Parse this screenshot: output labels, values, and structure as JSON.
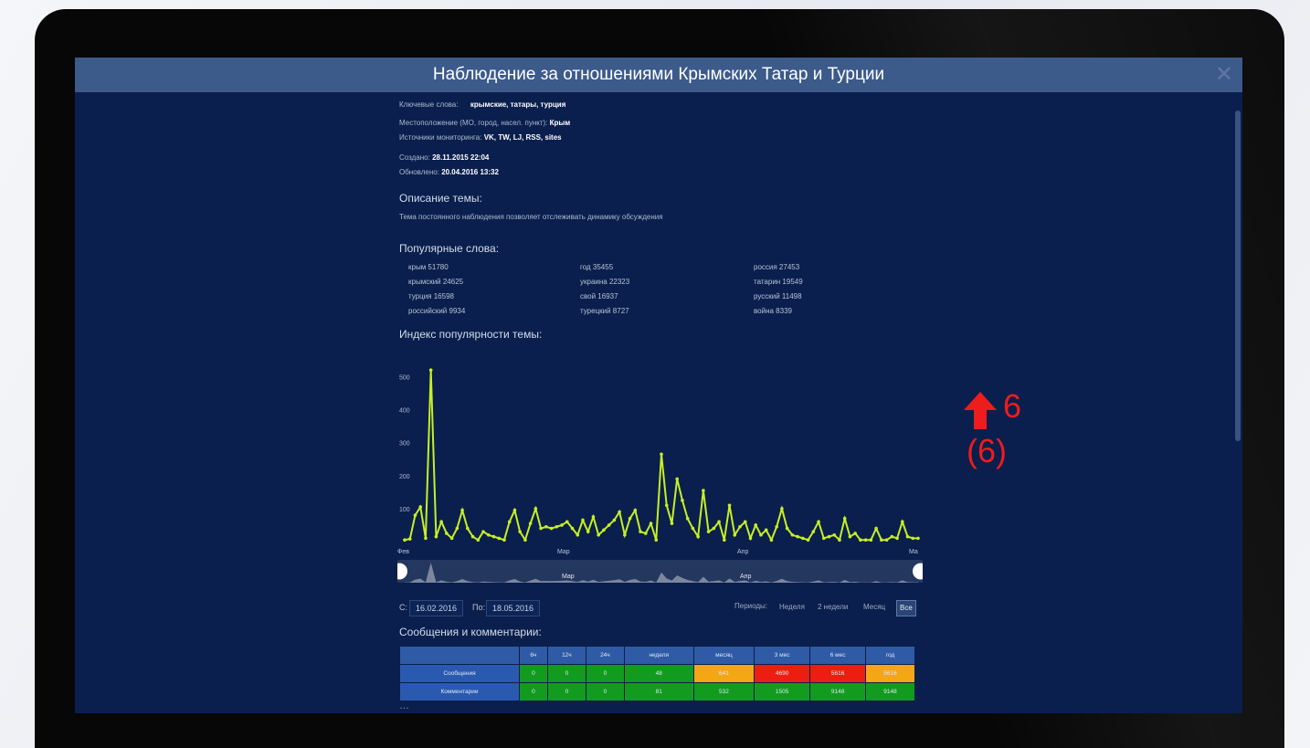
{
  "window": {
    "title": "Наблюдение за отношениями Крымских Татар и Турции",
    "close": "✕"
  },
  "meta": {
    "keywords_label": "Ключевые слова:",
    "keywords_value": "крымские, татары, турция",
    "location_label": "Местоположение (МО, город, насел. пункт):",
    "location_value": "Крым",
    "sources_label": "Источники мониторинга:",
    "sources_value": "VK, TW, LJ, RSS, sites",
    "created_label": "Создано:",
    "created_value": "28.11.2015 22:04",
    "updated_label": "Обновлено:",
    "updated_value": "20.04.2016 13:32"
  },
  "description": {
    "heading": "Описание темы:",
    "text": "Тема постоянного наблюдения позволяет отслеживать динамику обсуждения"
  },
  "popular_words": {
    "heading": "Популярные слова:",
    "columns": [
      [
        "крым 51780",
        "крымский 24625",
        "турция 16598",
        "российский 9934"
      ],
      [
        "год 35455",
        "украина 22323",
        "свой 16937",
        "турецкий 8727"
      ],
      [
        "россия 27453",
        "татарин 19549",
        "русский 11498",
        "война 8339"
      ]
    ]
  },
  "popularity": {
    "heading": "Индекс популярности темы:"
  },
  "chart_data": {
    "type": "line",
    "title": "",
    "y_ticks": [
      "500",
      "400",
      "300",
      "200",
      "100"
    ],
    "x_ticks": [
      "Фев",
      "Мар",
      "Апр",
      "Ма"
    ],
    "navigator_labels": [
      "Мар",
      "Апр"
    ],
    "ylim": [
      0,
      540
    ],
    "grid": false,
    "color": "#c7ef24",
    "values": [
      5,
      8,
      80,
      105,
      10,
      520,
      15,
      60,
      25,
      10,
      40,
      95,
      40,
      15,
      5,
      30,
      20,
      15,
      10,
      5,
      60,
      95,
      30,
      5,
      55,
      100,
      40,
      45,
      40,
      45,
      50,
      60,
      40,
      20,
      65,
      30,
      75,
      20,
      35,
      50,
      65,
      90,
      20,
      70,
      95,
      30,
      25,
      55,
      5,
      265,
      110,
      55,
      190,
      125,
      70,
      40,
      15,
      155,
      30,
      40,
      60,
      5,
      110,
      20,
      45,
      60,
      10,
      50,
      20,
      35,
      5,
      45,
      100,
      40,
      20,
      15,
      10,
      5,
      30,
      60,
      10,
      15,
      20,
      5,
      70,
      15,
      25,
      5,
      5,
      5,
      40,
      5,
      5,
      15,
      10,
      60,
      15,
      10,
      10
    ]
  },
  "range": {
    "from_label": "С:",
    "from_value": "16.02.2016",
    "to_label": "По:",
    "to_value": "18.05.2016"
  },
  "periods": {
    "label": "Периоды:",
    "options": [
      "Неделя",
      "2 недели",
      "Месяц",
      "Все"
    ],
    "active": "Все"
  },
  "stats": {
    "heading": "Сообщения и комментарии:",
    "columns": [
      "6ч",
      "12ч",
      "24ч",
      "неделя",
      "месяц",
      "3 мес",
      "6 мес",
      "год"
    ],
    "rows": [
      {
        "label": "Сообщения",
        "values": [
          "0",
          "0",
          "0",
          "48",
          "641",
          "4690",
          "5616",
          "5616"
        ],
        "status": [
          "green",
          "green",
          "green",
          "green",
          "yellow",
          "red",
          "red",
          "yellow"
        ]
      },
      {
        "label": "Комментарии",
        "values": [
          "0",
          "0",
          "0",
          "81",
          "532",
          "1505",
          "9148",
          "9148"
        ],
        "status": [
          "green",
          "green",
          "green",
          "green",
          "green",
          "green",
          "green",
          "green"
        ]
      }
    ],
    "status_colors": {
      "green": "#139b1f",
      "yellow": "#f3a714",
      "red": "#ee1d12"
    }
  },
  "trend": {
    "value": "6",
    "sub": "(6)",
    "icon": "arrow-up-icon",
    "color": "#ee1c1c"
  },
  "cut_off_text": "…"
}
